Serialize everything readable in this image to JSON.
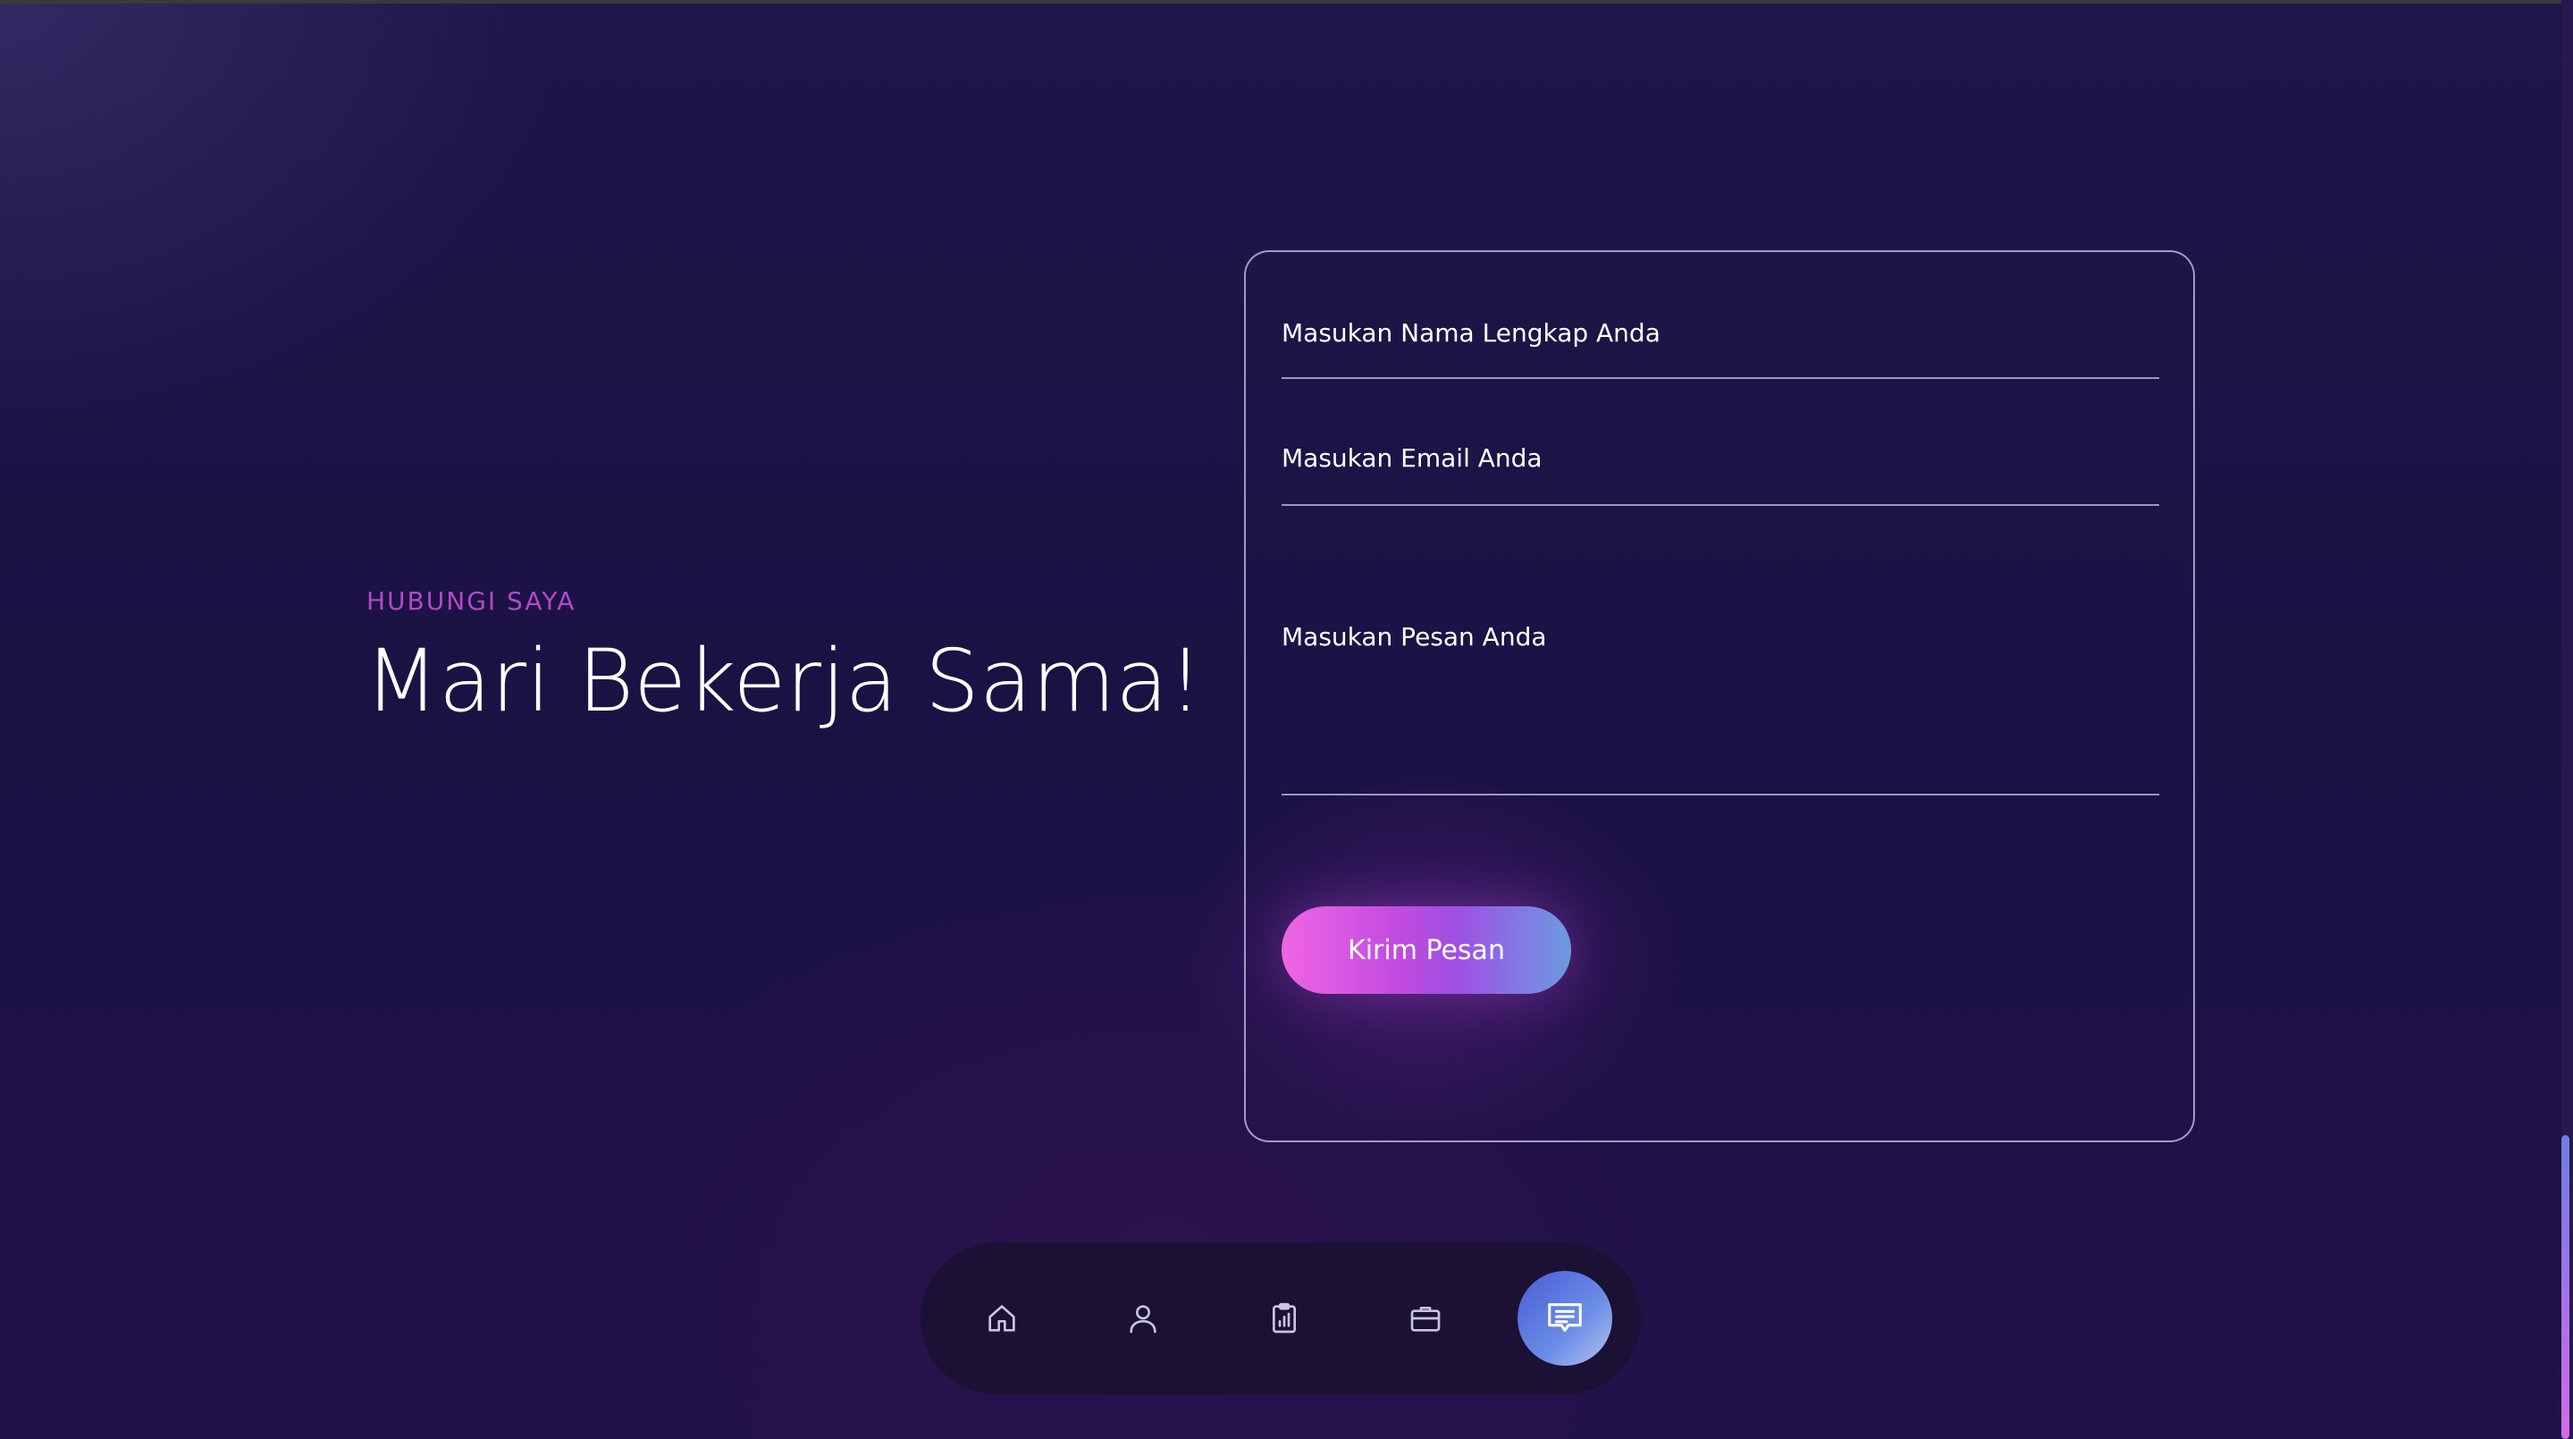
{
  "contact": {
    "eyebrow": "HUBUNGI SAYA",
    "headline": "Mari Bekerja Sama!"
  },
  "form": {
    "name_placeholder": "Masukan Nama Lengkap Anda",
    "email_placeholder": "Masukan Email Anda",
    "message_placeholder": "Masukan Pesan Anda",
    "submit_label": "Kirim Pesan"
  },
  "nav": {
    "items": [
      {
        "icon": "home-icon",
        "active": false
      },
      {
        "icon": "user-icon",
        "active": false
      },
      {
        "icon": "clipboard-chart-icon",
        "active": false
      },
      {
        "icon": "briefcase-icon",
        "active": false
      },
      {
        "icon": "message-icon",
        "active": true
      }
    ]
  },
  "colors": {
    "background": "#1c1346",
    "eyebrow": "#b348c9",
    "button_gradient_start": "#ef66e4",
    "button_gradient_end": "#6d9ae0",
    "nav_background": "#1a1134"
  }
}
